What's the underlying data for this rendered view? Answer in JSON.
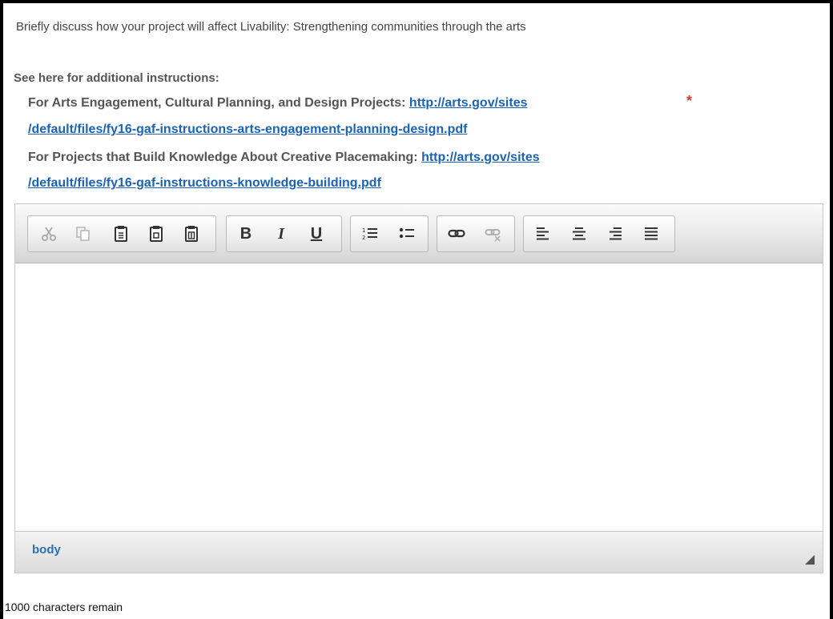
{
  "question": "Briefly discuss how your project will affect Livability: Strengthening communities through the arts",
  "instructions": {
    "heading": "See here for additional instructions:",
    "item1_label": "For Arts Engagement, Cultural Planning, and Design Projects:",
    "item1_link_part1": "http://arts.gov/sites",
    "item1_link_part2": "/default/files/fy16-gaf-instructions-arts-engagement-planning-design.pdf",
    "item2_label": "For Projects that Build Knowledge About Creative Placemaking:",
    "item2_link_part1": "http://arts.gov/sites",
    "item2_link_part2": "/default/files/fy16-gaf-instructions-knowledge-building.pdf"
  },
  "required_marker": "*",
  "toolbar": {
    "bold": "B",
    "italic": "I",
    "underline": "U"
  },
  "editor": {
    "content": "",
    "status_path": "body"
  },
  "char_remaining": "1000 characters remain",
  "icons": [
    "cut-icon",
    "copy-icon",
    "paste-icon",
    "paste-text-icon",
    "paste-word-icon",
    "bold-icon",
    "italic-icon",
    "underline-icon",
    "numbered-list-icon",
    "bulleted-list-icon",
    "link-icon",
    "unlink-icon",
    "align-left-icon",
    "align-center-icon",
    "align-right-icon",
    "justify-icon",
    "resize-handle-icon"
  ],
  "colors": {
    "link": "#1a63b8",
    "required": "#e03030",
    "path": "#2a6fb7"
  }
}
